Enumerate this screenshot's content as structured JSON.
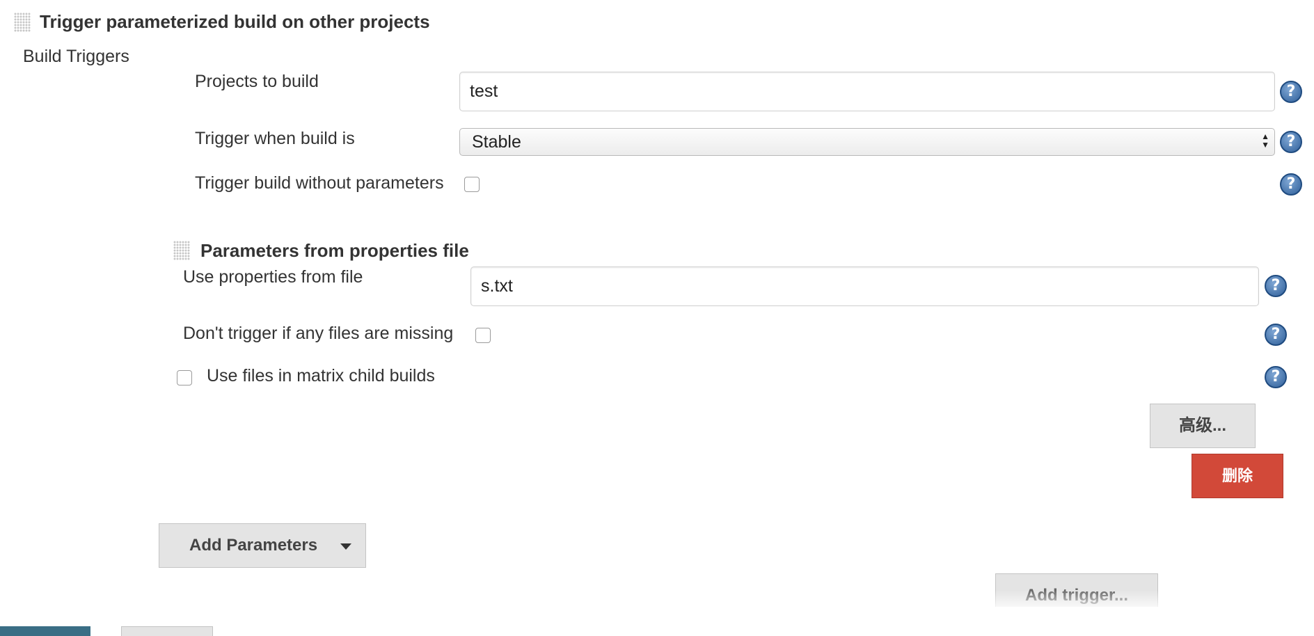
{
  "header": {
    "title": "Trigger parameterized build on other projects"
  },
  "section": {
    "label": "Build Triggers"
  },
  "fields": {
    "projects": {
      "label": "Projects to build",
      "value": "test"
    },
    "trigger_when": {
      "label": "Trigger when build is",
      "selected": "Stable"
    },
    "no_params": {
      "label": "Trigger build without parameters",
      "checked": false
    }
  },
  "params_section": {
    "title": "Parameters from properties file",
    "use_file": {
      "label": "Use properties from file",
      "value": "s.txt"
    },
    "missing": {
      "label": "Don't trigger if any files are missing",
      "checked": false
    },
    "matrix": {
      "label": "Use files in matrix child builds",
      "checked": false
    }
  },
  "buttons": {
    "advanced": "高级...",
    "delete": "删除",
    "add_parameters": "Add Parameters",
    "add_trigger": "Add trigger..."
  },
  "icons": {
    "help": "help-icon",
    "drag": "drag-handle-icon",
    "dropdown": "caret-down-icon",
    "select_arrows": "select-arrows-icon"
  },
  "colors": {
    "help_blue": "#2f5f99",
    "delete_red": "#d24939",
    "button_gray": "#e4e4e4",
    "save_teal": "#3a6e85"
  }
}
